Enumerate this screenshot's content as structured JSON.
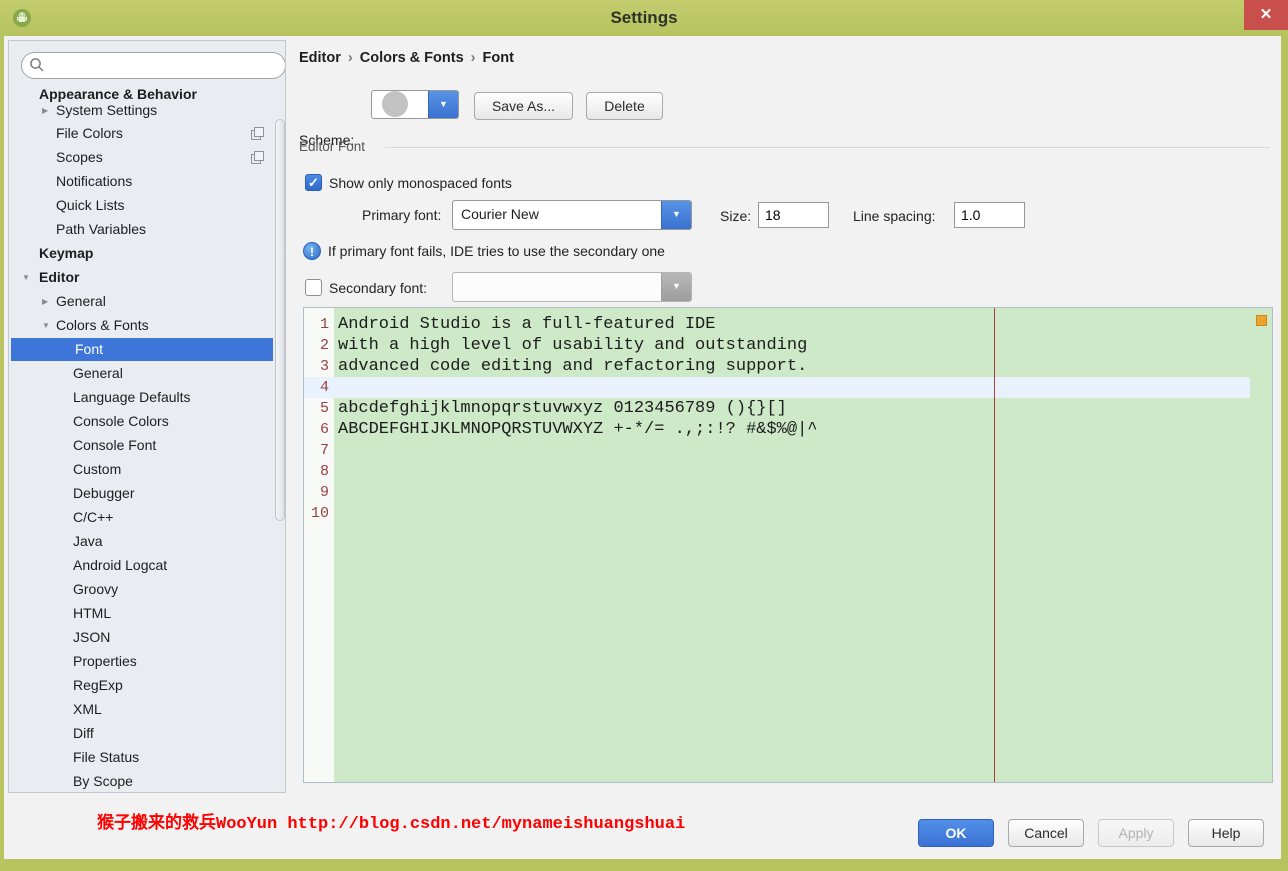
{
  "window": {
    "title": "Settings"
  },
  "icons": {
    "close": "✕",
    "check": "✓",
    "dropdown_arrow": "▼",
    "chevron_right": "▶",
    "chevron_down": "▼",
    "info": "!"
  },
  "sidebar": {
    "search_value": "",
    "items": [
      {
        "label": "Appearance & Behavior",
        "level": 1,
        "bold": true
      },
      {
        "label": "System Settings",
        "level": 2,
        "arrow": "right"
      },
      {
        "label": "File Colors",
        "level": 2,
        "trailing_icon": "copy"
      },
      {
        "label": "Scopes",
        "level": 2,
        "trailing_icon": "copy"
      },
      {
        "label": "Notifications",
        "level": 2
      },
      {
        "label": "Quick Lists",
        "level": 2
      },
      {
        "label": "Path Variables",
        "level": 2
      },
      {
        "label": "Keymap",
        "level": 1,
        "bold": true
      },
      {
        "label": "Editor",
        "level": 1,
        "bold": true,
        "arrow": "down"
      },
      {
        "label": "General",
        "level": 2,
        "arrow": "right"
      },
      {
        "label": "Colors & Fonts",
        "level": 2,
        "arrow": "down"
      },
      {
        "label": "Font",
        "level": 3,
        "selected": true
      },
      {
        "label": "General",
        "level": 3
      },
      {
        "label": "Language Defaults",
        "level": 3
      },
      {
        "label": "Console Colors",
        "level": 3
      },
      {
        "label": "Console Font",
        "level": 3
      },
      {
        "label": "Custom",
        "level": 3
      },
      {
        "label": "Debugger",
        "level": 3
      },
      {
        "label": "C/C++",
        "level": 3
      },
      {
        "label": "Java",
        "level": 3
      },
      {
        "label": "Android Logcat",
        "level": 3
      },
      {
        "label": "Groovy",
        "level": 3
      },
      {
        "label": "HTML",
        "level": 3
      },
      {
        "label": "JSON",
        "level": 3
      },
      {
        "label": "Properties",
        "level": 3
      },
      {
        "label": "RegExp",
        "level": 3
      },
      {
        "label": "XML",
        "level": 3
      },
      {
        "label": "Diff",
        "level": 3
      },
      {
        "label": "File Status",
        "level": 3
      },
      {
        "label": "By Scope",
        "level": 3
      }
    ]
  },
  "main": {
    "breadcrumb": [
      "Editor",
      "Colors & Fonts",
      "Font"
    ],
    "breadcrumb_separator": "›",
    "scheme": {
      "label": "Scheme:",
      "value": "",
      "value_censored": true,
      "save_as_label": "Save As...",
      "delete_label": "Delete"
    },
    "editor_font": {
      "group_label": "Editor Font",
      "show_monospaced_label": "Show only monospaced fonts",
      "show_monospaced_checked": true,
      "primary_font_label": "Primary font:",
      "primary_font_value": "Courier New",
      "size_label": "Size:",
      "size_value": "18",
      "line_spacing_label": "Line spacing:",
      "line_spacing_value": "1.0",
      "info_text": "If primary font fails, IDE tries to use the secondary one",
      "secondary_font_label": "Secondary font:",
      "secondary_font_value": "",
      "secondary_font_checked": false
    },
    "preview": {
      "lines": [
        {
          "num": "1",
          "text": "Android Studio is a full-featured IDE"
        },
        {
          "num": "2",
          "text": "with a high level of usability and outstanding"
        },
        {
          "num": "3",
          "text": "advanced code editing and refactoring support."
        },
        {
          "num": "4",
          "text": "",
          "caret_line": true
        },
        {
          "num": "5",
          "text": "abcdefghijklmnopqrstuvwxyz 0123456789 (){}[]"
        },
        {
          "num": "6",
          "text": "ABCDEFGHIJKLMNOPQRSTUVWXYZ +-*/= .,;:!? #&$%@|^"
        },
        {
          "num": "7",
          "text": ""
        },
        {
          "num": "8",
          "text": ""
        },
        {
          "num": "9",
          "text": ""
        },
        {
          "num": "10",
          "text": ""
        }
      ]
    }
  },
  "footer": {
    "watermark": "猴子搬来的救兵WooYun http://blog.csdn.net/mynameishuangshuai",
    "buttons": [
      {
        "label": "OK",
        "primary": true
      },
      {
        "label": "Cancel"
      },
      {
        "label": "Apply",
        "disabled": true
      },
      {
        "label": "Help"
      }
    ]
  },
  "colors": {
    "titlebar": "#b7c35f",
    "closered": "#c94f4c",
    "sidebarbg": "#e9edf2",
    "contentbg": "#f2f2f2",
    "selection": "#3d76d8",
    "accent": "#3f7cd6",
    "okblue": "#3e79d9",
    "editorgreen": "#cde9c8",
    "caretline": "#e8f1fc",
    "gutterbg": "#f7faf6",
    "linenumber": "#984141",
    "marginred": "#b03e3e",
    "orangemark": "#efa32f",
    "watermarkred": "#ff0000"
  }
}
